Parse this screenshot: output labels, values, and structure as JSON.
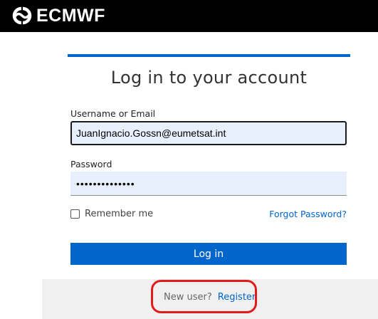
{
  "header": {
    "logo_text": "ECMWF",
    "logo_icon": "ecmwf-logo-icon"
  },
  "login": {
    "title": "Log in to your account",
    "username_label": "Username or Email",
    "username_value": "JuanIgnacio.Gossn@eumetsat.int",
    "password_label": "Password",
    "password_value": "••••••••••••••",
    "remember_label": "Remember me",
    "remember_checked": false,
    "forgot_label": "Forgot Password?",
    "submit_label": "Log in"
  },
  "footer": {
    "new_user_text": "New user?",
    "register_label": "Register"
  },
  "colors": {
    "brand_blue": "#0066cc",
    "header_bg": "#000000",
    "input_bg": "#e8f0fe",
    "annotation_red": "#e41a1a"
  }
}
